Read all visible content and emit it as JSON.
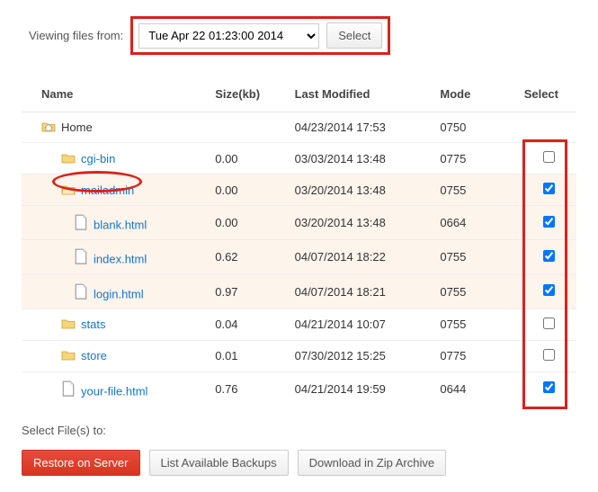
{
  "header": {
    "label": "Viewing files from:",
    "date_option": "Tue Apr 22 01:23:00 2014",
    "select_btn": "Select"
  },
  "columns": {
    "name": "Name",
    "size": "Size(kb)",
    "modified": "Last Modified",
    "mode": "Mode",
    "select": "Select"
  },
  "rows": [
    {
      "name": "Home",
      "icon": "home",
      "indent": 0,
      "link": false,
      "size": "",
      "modified": "04/23/2014 17:53",
      "mode": "0750",
      "checkbox": false,
      "checked": false,
      "shade": false
    },
    {
      "name": "cgi-bin",
      "icon": "folder",
      "indent": 1,
      "link": true,
      "size": "0.00",
      "modified": "03/03/2014 13:48",
      "mode": "0775",
      "checkbox": true,
      "checked": false,
      "shade": false
    },
    {
      "name": "mailadmin",
      "icon": "folder-open",
      "indent": 1,
      "link": true,
      "size": "0.00",
      "modified": "03/20/2014 13:48",
      "mode": "0755",
      "checkbox": true,
      "checked": true,
      "shade": true,
      "circled": true
    },
    {
      "name": "blank.html",
      "icon": "file",
      "indent": 2,
      "link": true,
      "size": "0.00",
      "modified": "03/20/2014 13:48",
      "mode": "0664",
      "checkbox": true,
      "checked": true,
      "shade": true
    },
    {
      "name": "index.html",
      "icon": "file",
      "indent": 2,
      "link": true,
      "size": "0.62",
      "modified": "04/07/2014 18:22",
      "mode": "0755",
      "checkbox": true,
      "checked": true,
      "shade": true
    },
    {
      "name": "login.html",
      "icon": "file",
      "indent": 2,
      "link": true,
      "size": "0.97",
      "modified": "04/07/2014 18:21",
      "mode": "0755",
      "checkbox": true,
      "checked": true,
      "shade": true
    },
    {
      "name": "stats",
      "icon": "folder",
      "indent": 1,
      "link": true,
      "size": "0.04",
      "modified": "04/21/2014 10:07",
      "mode": "0755",
      "checkbox": true,
      "checked": false,
      "shade": false
    },
    {
      "name": "store",
      "icon": "folder",
      "indent": 1,
      "link": true,
      "size": "0.01",
      "modified": "07/30/2012 15:25",
      "mode": "0775",
      "checkbox": true,
      "checked": false,
      "shade": false
    },
    {
      "name": "your-file.html",
      "icon": "file",
      "indent": 1,
      "link": true,
      "size": "0.76",
      "modified": "04/21/2014 19:59",
      "mode": "0644",
      "checkbox": true,
      "checked": true,
      "shade": false
    }
  ],
  "footer": {
    "label": "Select File(s) to:",
    "restore": "Restore on Server",
    "list": "List Available Backups",
    "download": "Download in Zip Archive"
  }
}
